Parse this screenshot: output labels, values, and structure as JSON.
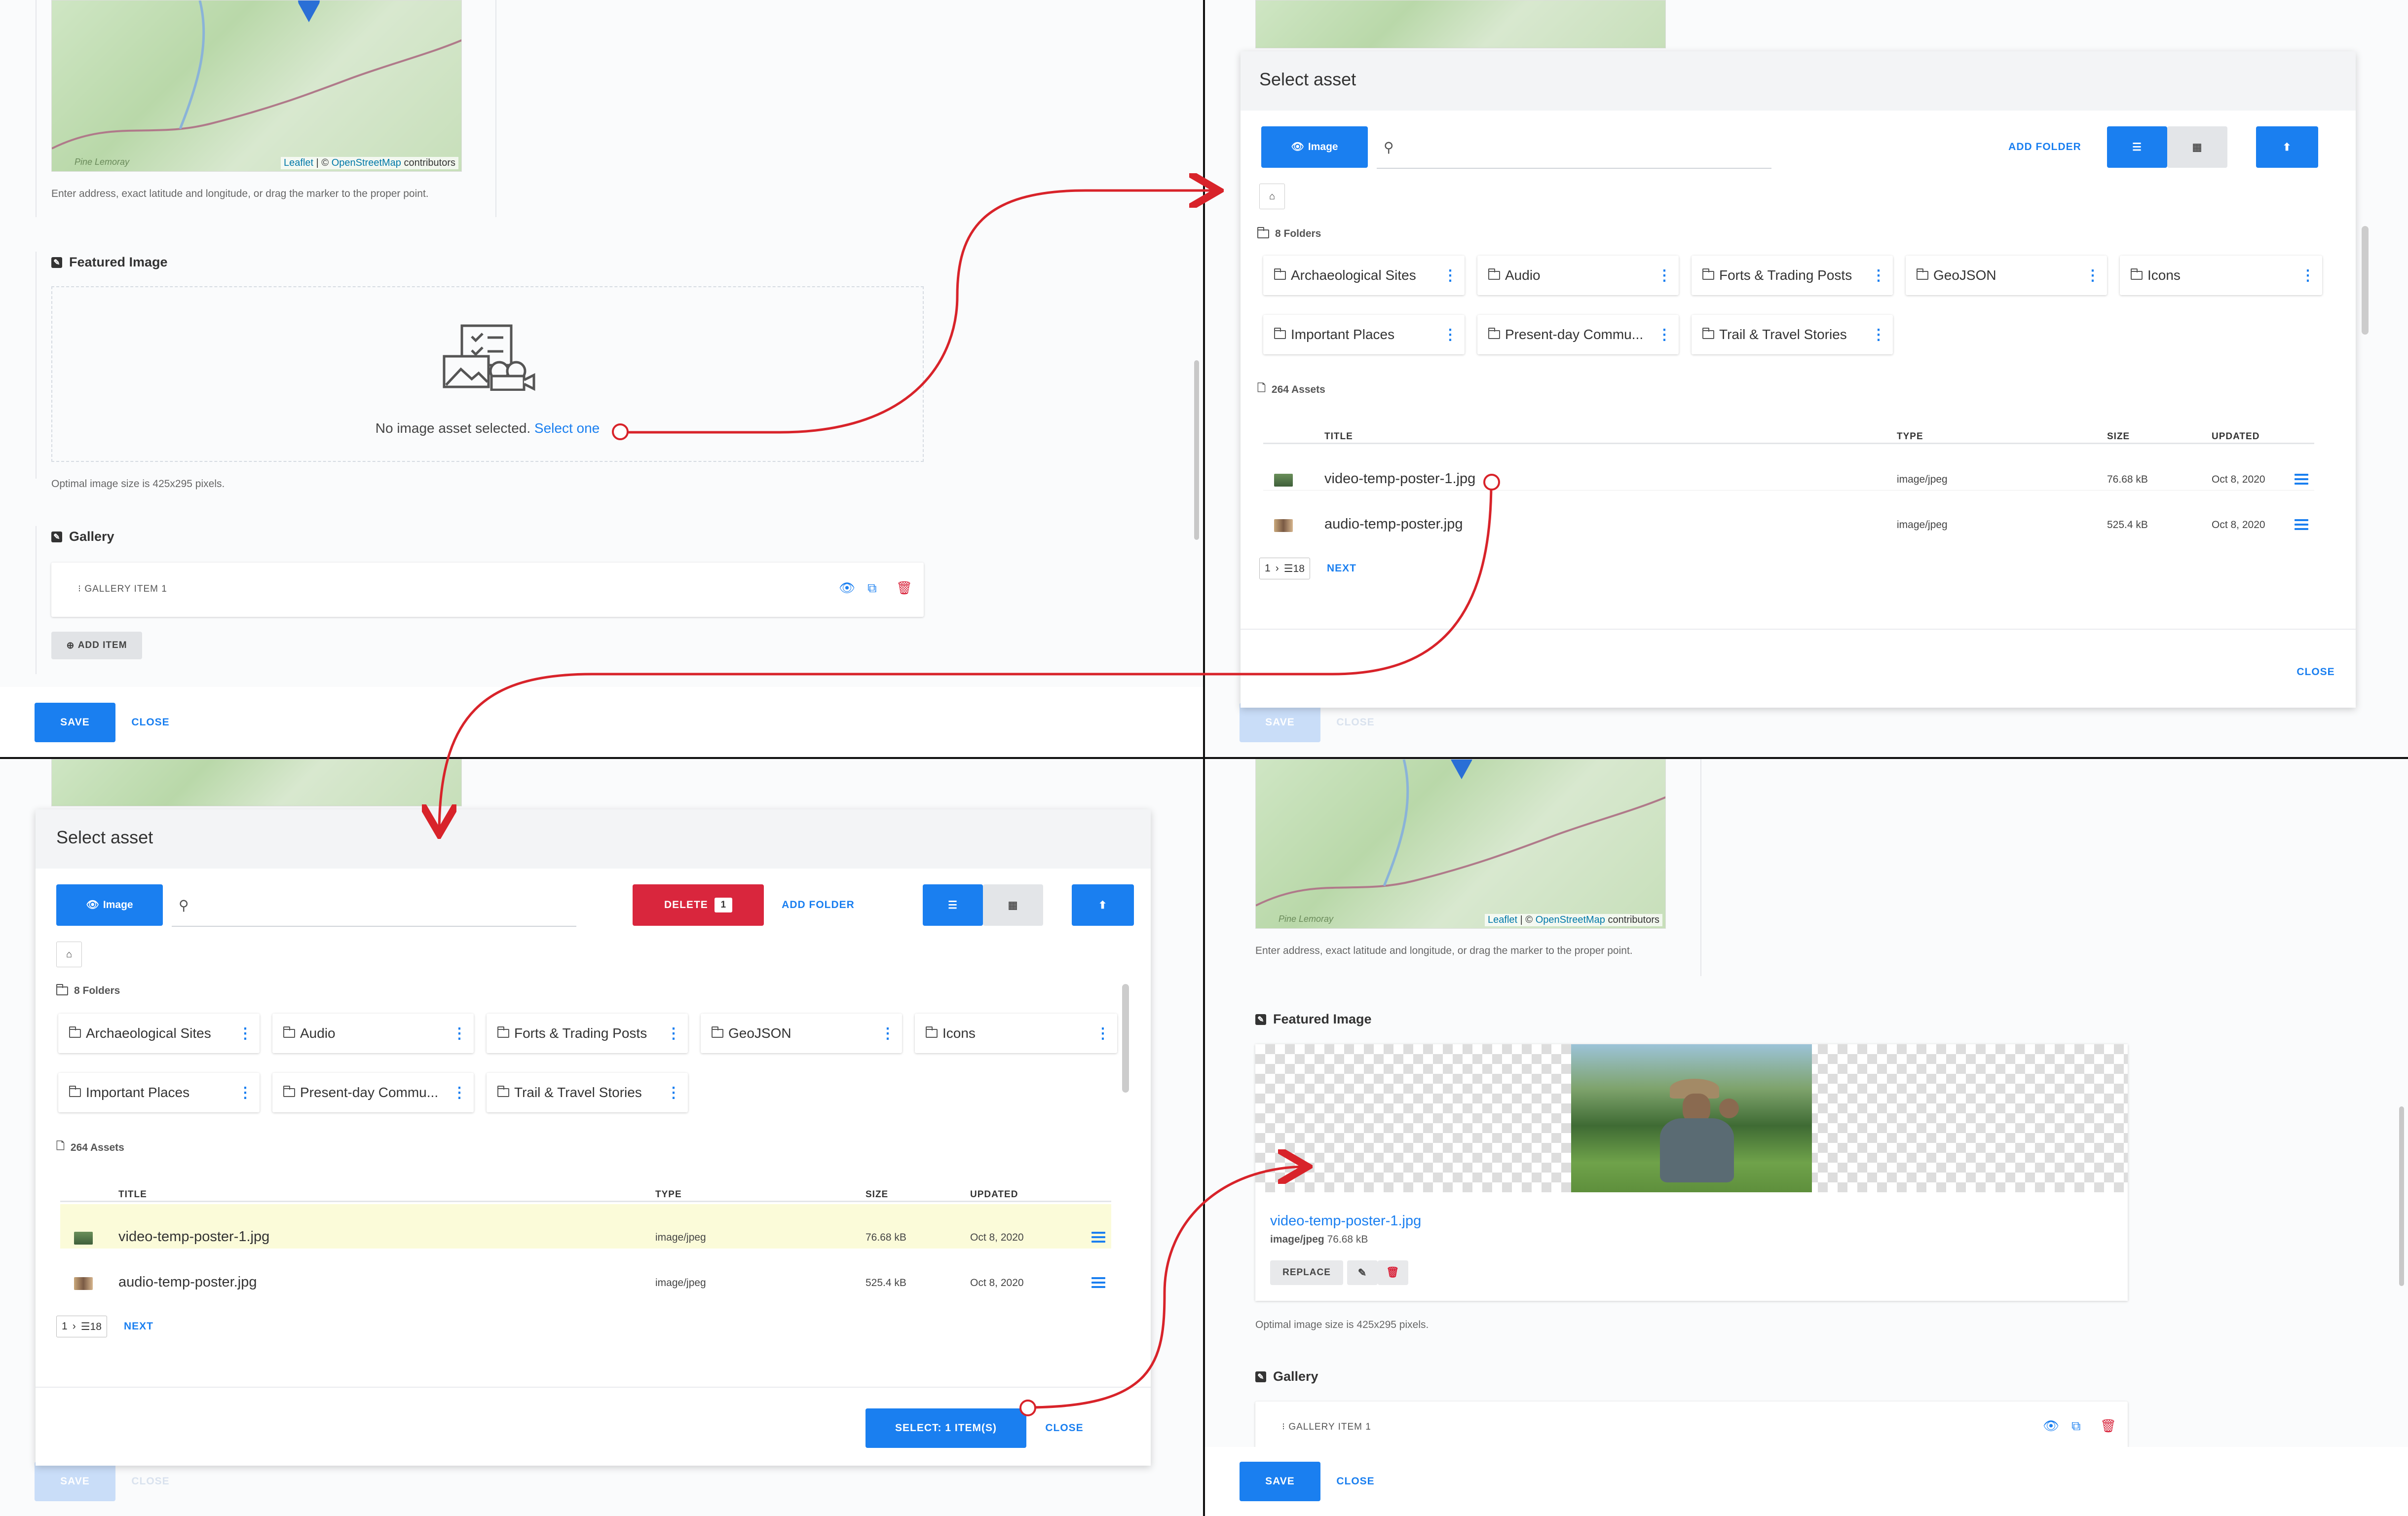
{
  "colors": {
    "primary": "#1a7ff0",
    "danger": "#d9263d",
    "annotation": "#d8232a"
  },
  "map": {
    "leaflet": "Leaflet",
    "sep": "| ©",
    "osm": "OpenStreetMap",
    "contributors": "contributors",
    "place": "Pine Lemoray"
  },
  "location_help": "Enter address, exact latitude and longitude, or drag the marker to the proper point.",
  "featured": {
    "title": "Featured Image",
    "empty_text": "No image asset selected.",
    "select_link": "Select one",
    "optimal": "Optimal image size is 425x295 pixels.",
    "selected_name": "video-temp-poster-1.jpg",
    "selected_type": "image/jpeg",
    "selected_size": "76.68 kB",
    "replace": "REPLACE"
  },
  "gallery": {
    "title": "Gallery",
    "item": "GALLERY ITEM 1",
    "add_item": "ADD ITEM"
  },
  "footer": {
    "save": "SAVE",
    "close": "CLOSE"
  },
  "modal": {
    "title": "Select asset",
    "filter_btn": "Image",
    "add_folder": "ADD FOLDER",
    "delete": "DELETE",
    "delete_count": "1",
    "folders_count": "8 Folders",
    "assets_count": "264 Assets",
    "folders": [
      "Archaeological Sites",
      "Audio",
      "Forts & Trading Posts",
      "GeoJSON",
      "Icons",
      "Important Places",
      "Present-day Commu...",
      "Trail & Travel Stories"
    ],
    "columns": {
      "title": "TITLE",
      "type": "TYPE",
      "size": "SIZE",
      "updated": "UPDATED"
    },
    "rows": [
      {
        "name": "video-temp-poster-1.jpg",
        "type": "image/jpeg",
        "size": "76.68 kB",
        "updated": "Oct 8, 2020"
      },
      {
        "name": "audio-temp-poster.jpg",
        "type": "image/jpeg",
        "size": "525.4 kB",
        "updated": "Oct 8, 2020"
      }
    ],
    "page": "1",
    "per_page": "18",
    "next": "NEXT",
    "close": "CLOSE",
    "select_btn": "SELECT: 1 ITEM(S)"
  }
}
